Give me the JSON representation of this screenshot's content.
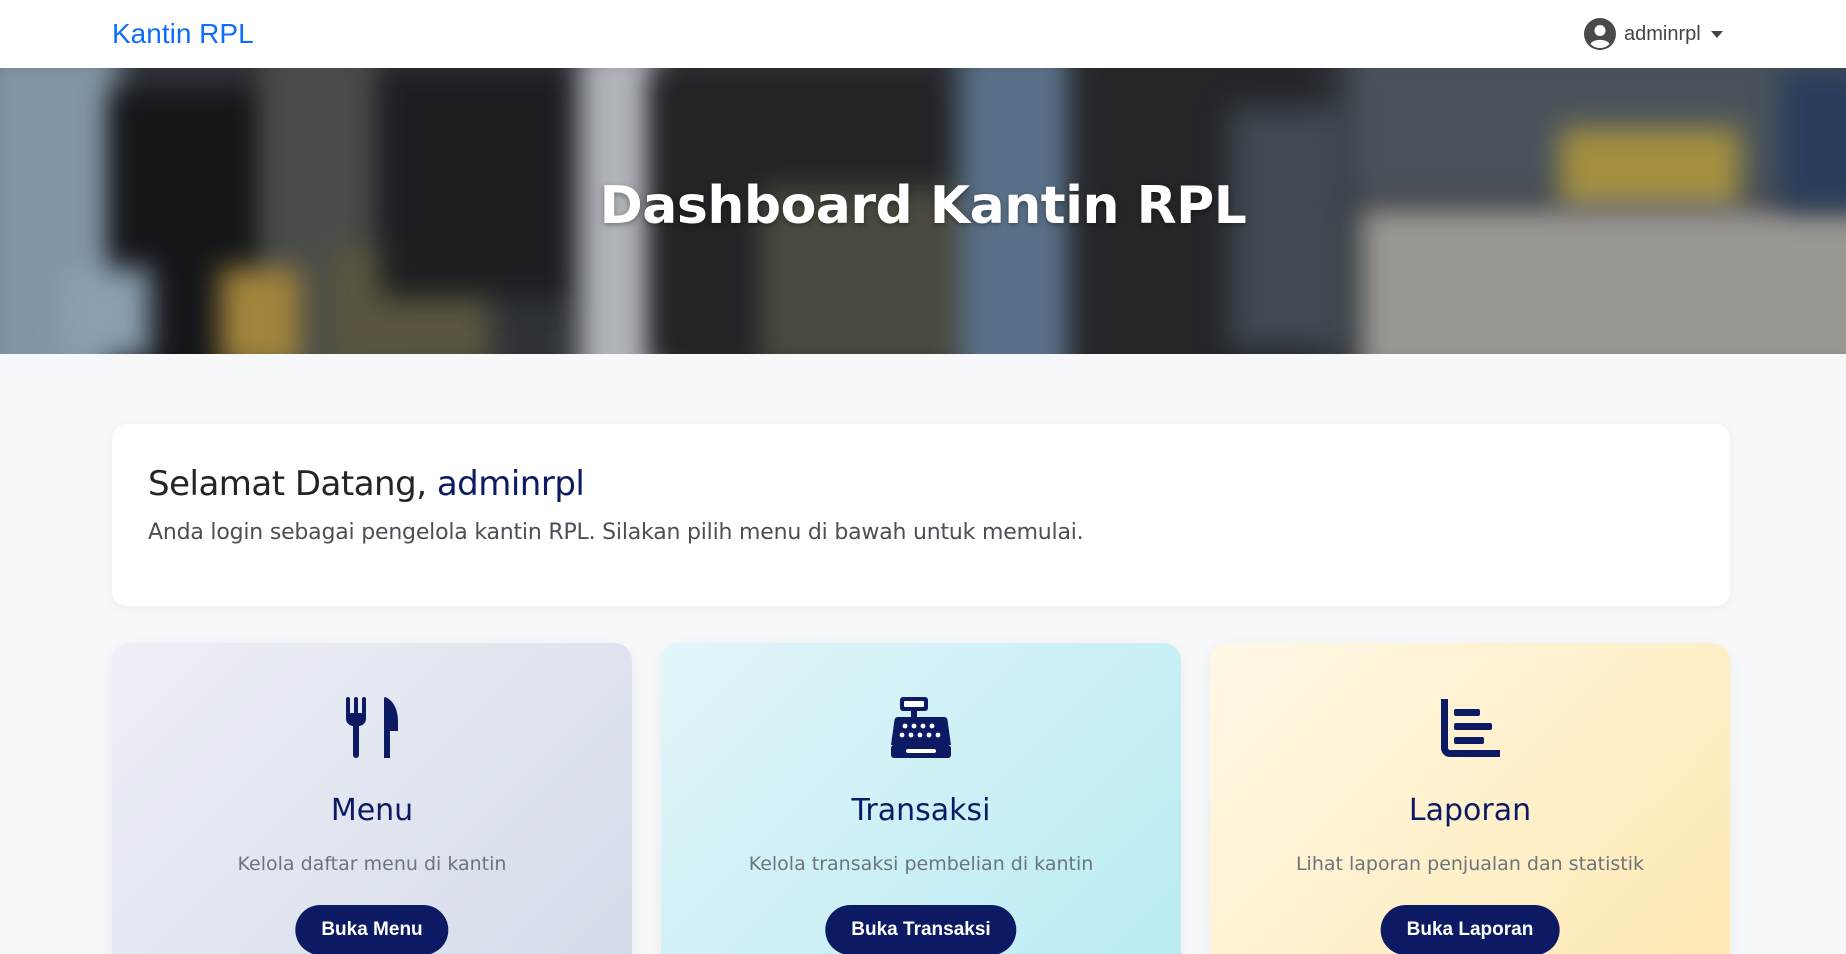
{
  "navbar": {
    "brand": "Kantin RPL",
    "user": {
      "name": "adminrpl",
      "avatar_icon": "user-circle-icon"
    }
  },
  "hero": {
    "title": "Dashboard Kantin RPL"
  },
  "welcome": {
    "greeting": "Selamat Datang,",
    "username": "adminrpl",
    "message": "Anda login sebagai pengelola kantin RPL. Silakan pilih menu di bawah untuk memulai."
  },
  "cards": [
    {
      "icon": "utensils-icon",
      "title": "Menu",
      "description": "Kelola daftar menu di kantin",
      "button": "Buka Menu"
    },
    {
      "icon": "cash-register-icon",
      "title": "Transaksi",
      "description": "Kelola transaksi pembelian di kantin",
      "button": "Buka Transaksi"
    },
    {
      "icon": "chart-bar-icon",
      "title": "Laporan",
      "description": "Lihat laporan penjualan dan statistik",
      "button": "Buka Laporan"
    }
  ],
  "colors": {
    "brand": "#0d6efd",
    "primary_dark": "#0b1a63",
    "background": "#f6f8fa"
  }
}
